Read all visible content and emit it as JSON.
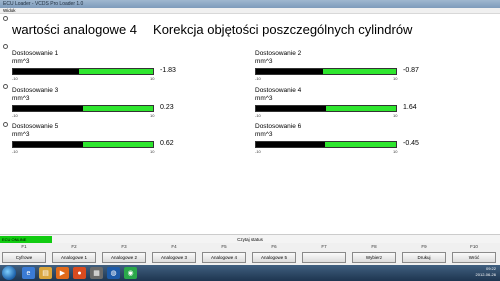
{
  "window": {
    "title": "ECU Loader  -  VCDS Pro Loader 1.0",
    "menu": "Widok"
  },
  "page": {
    "title": "wartości analogowe 4",
    "subtitle": "Korekcja objętości poszczególnych cylindrów"
  },
  "gauges": [
    {
      "label": "Dostosowanie 1",
      "unit": "mm^3",
      "value": "-1.83",
      "fill": 0.47,
      "min": "-10",
      "max": "10"
    },
    {
      "label": "Dostosowanie 2",
      "unit": "mm^3",
      "value": "-0.87",
      "fill": 0.48,
      "min": "-10",
      "max": "10"
    },
    {
      "label": "Dostosowanie 3",
      "unit": "mm^3",
      "value": "0.23",
      "fill": 0.5,
      "min": "-10",
      "max": "10"
    },
    {
      "label": "Dostosowanie 4",
      "unit": "mm^3",
      "value": "1.64",
      "fill": 0.5,
      "min": "-10",
      "max": "10"
    },
    {
      "label": "Dostosowanie 5",
      "unit": "mm^3",
      "value": "0.62",
      "fill": 0.5,
      "min": "-10",
      "max": "10"
    },
    {
      "label": "Dostosowanie 6",
      "unit": "mm^3",
      "value": "-0.45",
      "fill": 0.49,
      "min": "-10",
      "max": "10"
    }
  ],
  "status": {
    "left": "ECU ONLINE",
    "center": "Czytaj status"
  },
  "fkeys": [
    {
      "key": "F1",
      "label": "Cyfrowe"
    },
    {
      "key": "F2",
      "label": "Analogowe 1"
    },
    {
      "key": "F3",
      "label": "Analogowe 2"
    },
    {
      "key": "F4",
      "label": "Analogowe 3"
    },
    {
      "key": "F5",
      "label": "Analogowe 4"
    },
    {
      "key": "F6",
      "label": "Analogowe 5"
    },
    {
      "key": "F7",
      "label": ""
    },
    {
      "key": "F8",
      "label": "Wybierz"
    },
    {
      "key": "F9",
      "label": "Drukuj"
    },
    {
      "key": "F10",
      "label": "Wróć"
    }
  ],
  "taskbar": {
    "time": "09:22",
    "date": "2012-06-26"
  },
  "colors": {
    "bar_green": "#2ee62e",
    "status_green": "#11cc11"
  }
}
